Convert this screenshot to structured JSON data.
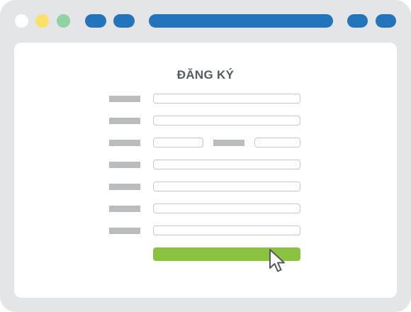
{
  "window": {
    "traffic_lights": [
      "#ffffff",
      "#fbe16a",
      "#8fd3a2"
    ],
    "accent_color": "#2474bd",
    "toolbar_icons": [
      "back-button-icon",
      "forward-button-icon",
      "address-bar",
      "extension-icon",
      "menu-icon"
    ]
  },
  "form": {
    "title": "ĐĂNG KÝ",
    "title_color": "#555a60",
    "label_placeholder_color": "#bbbcbe",
    "field_border_color": "#c6c7c9",
    "rows": [
      {
        "type": "text"
      },
      {
        "type": "text"
      },
      {
        "type": "split"
      },
      {
        "type": "text"
      },
      {
        "type": "text"
      },
      {
        "type": "text"
      },
      {
        "type": "text"
      }
    ],
    "submit_button_color": "#8bc241",
    "cursor_icon": "arrow-cursor-icon"
  }
}
